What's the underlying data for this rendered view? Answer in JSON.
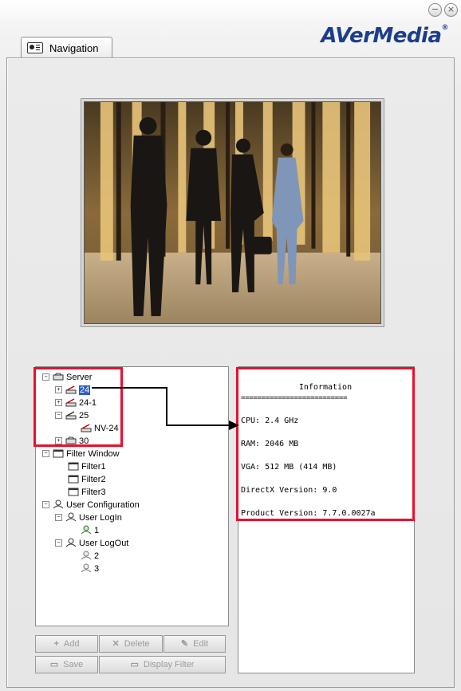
{
  "window": {
    "minimize_glyph": "−",
    "close_glyph": "×",
    "brand": "AVerMedia",
    "brand_reg": "®",
    "tab_label": "Navigation"
  },
  "tree": {
    "server_label": "Server",
    "servers": [
      {
        "label": "24",
        "selected": true
      },
      {
        "label": "24-1"
      },
      {
        "label": "25"
      },
      {
        "label": "NV-24"
      },
      {
        "label": "30"
      }
    ],
    "filter_window_label": "Filter Window",
    "filters": [
      "Filter1",
      "Filter2",
      "Filter3"
    ],
    "user_config_label": "User Configuration",
    "user_login_label": "User LogIn",
    "login_users": [
      "1"
    ],
    "user_logout_label": "User LogOut",
    "logout_users": [
      "2",
      "3"
    ]
  },
  "info": {
    "title": "Information",
    "separator": "==========================",
    "cpu": "CPU: 2.4 GHz",
    "ram": "RAM: 2046 MB",
    "vga": "VGA: 512 MB (414 MB)",
    "directx": "DirectX Version: 9.0",
    "product": "Product Version: 7.7.0.0027a"
  },
  "buttons": {
    "add": "Add",
    "delete": "Delete",
    "edit": "Edit",
    "save": "Save",
    "display_filter": "Display Filter"
  },
  "colors": {
    "highlight": "#e8102d",
    "brand": "#1c3e8a",
    "selection": "#2f5cc6"
  },
  "icons": [
    "minimize-icon",
    "close-icon",
    "navigation-tab-icon",
    "server-icon",
    "dvr-icon",
    "filter-window-icon",
    "user-icon",
    "add-icon",
    "delete-icon",
    "edit-icon",
    "save-icon",
    "display-filter-icon",
    "arrow-icon"
  ]
}
